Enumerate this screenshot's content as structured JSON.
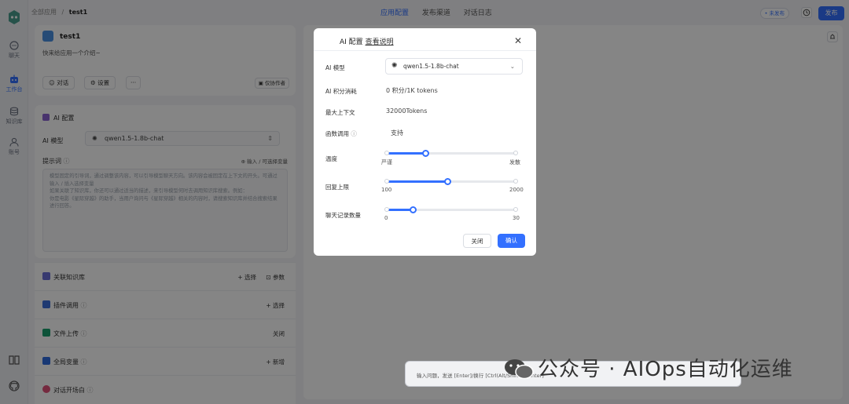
{
  "nav": {
    "items": [
      {
        "label": "聊天",
        "icon": "chat-icon"
      },
      {
        "label": "工作台",
        "icon": "robot-icon"
      },
      {
        "label": "知识库",
        "icon": "database-icon"
      },
      {
        "label": "账号",
        "icon": "user-icon"
      }
    ],
    "bottom_icons": [
      "book-icon",
      "github-icon"
    ]
  },
  "breadcrumb": {
    "parent": "全部应用",
    "separator": "/",
    "current": "test1"
  },
  "tabs": [
    "应用配置",
    "发布渠道",
    "对话日志"
  ],
  "active_tab": "应用配置",
  "header": {
    "status": "• 未发布",
    "publish_label": "发布",
    "history_icon": "clock-icon"
  },
  "app": {
    "name": "test1",
    "description": "快来给应用一个介绍~",
    "chat_label": "对话",
    "settings_label": "设置",
    "more_label": "···",
    "author_label": "仅协作者"
  },
  "ai_config": {
    "title": "AI 配置",
    "model_label": "AI 模型",
    "model_value": "qwen1.5-1.8b-chat",
    "prompt_label": "提示词",
    "prompt_hint": "⊕ 输入 / 可选择变量",
    "prompt_placeholder": "模型固定的引导词，通过调整该内容，可以引导模型聊天方向。该内容会被固定在上下文的开头。可通过输入 / 插入选择变量\n如果关联了知识库，你还可以通过适当的描述，来引导模型何时去调用知识库搜索。例如：\n你是电影《星际穿越》的助手，当用户询问与《星际穿越》相关的内容时，请搜索知识库并结合搜索结果进行回答。"
  },
  "tools": [
    {
      "name": "关联知识库",
      "action": "+ 选择",
      "action2": "参数",
      "icon_color": "#6b6fd6"
    },
    {
      "name": "插件调用",
      "action": "+ 选择",
      "icon_color": "#3d6fdb"
    },
    {
      "name": "文件上传",
      "action": "关闭",
      "icon_color": "#1aa06d"
    },
    {
      "name": "全局变量",
      "action": "+ 新增",
      "icon_color": "#2f6bde"
    },
    {
      "name": "对话开场白",
      "action": "",
      "icon_color": "#e0527a"
    }
  ],
  "modal": {
    "title": "AI 配置",
    "doc_link": "查看说明",
    "model_label": "AI 模型",
    "model_value": "qwen1.5-1.8b-chat",
    "cost_label": "AI 积分消耗",
    "cost_value": "0 积分/1K tokens",
    "context_label": "最大上下文",
    "context_value": "32000Tokens",
    "function_label": "函数调用",
    "function_value": "支持",
    "temperature": {
      "label": "温度",
      "min_label": "严谨",
      "max_label": "发散",
      "fraction": 0.3
    },
    "max_reply": {
      "label": "回复上限",
      "min": "100",
      "max": "2000",
      "fraction": 0.47
    },
    "history": {
      "label": "聊天记录数量",
      "min": "0",
      "max": "30",
      "fraction": 0.2
    },
    "close_label": "关闭",
    "confirm_label": "确认"
  },
  "chat_input": {
    "placeholder": "输入问题，发送 [Enter]/换行 [Ctrl(Alt/Shift) + Enter]"
  },
  "watermark": "公众号 · AIOps自动化运维",
  "colors": {
    "accent": "#3370ff",
    "overlay": "rgba(0,0,0,0.48)"
  }
}
